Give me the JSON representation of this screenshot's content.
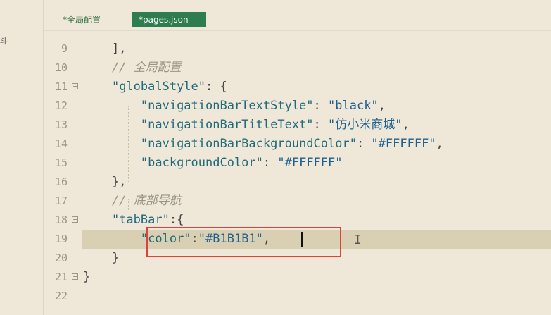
{
  "left_panel": {
    "clipped_text": "斗"
  },
  "tabs": [
    {
      "label": "*全局配置",
      "active": false
    },
    {
      "label": "*pages.json",
      "active": true
    }
  ],
  "editor": {
    "current_line": "19",
    "lines": [
      {
        "num": "9",
        "tokens": [
          {
            "t": "p",
            "v": "    ],"
          }
        ]
      },
      {
        "num": "10",
        "tokens": [
          {
            "t": "c",
            "v": "    // 全局配置"
          }
        ]
      },
      {
        "num": "11",
        "fold": true,
        "tokens": [
          {
            "t": "p",
            "v": "    "
          },
          {
            "t": "k",
            "v": "\"globalStyle\""
          },
          {
            "t": "p",
            "v": ": {"
          }
        ]
      },
      {
        "num": "12",
        "tokens": [
          {
            "t": "p",
            "v": "        "
          },
          {
            "t": "k",
            "v": "\"navigationBarTextStyle\""
          },
          {
            "t": "p",
            "v": ": "
          },
          {
            "t": "s",
            "v": "\"black\""
          },
          {
            "t": "p",
            "v": ","
          }
        ]
      },
      {
        "num": "13",
        "tokens": [
          {
            "t": "p",
            "v": "        "
          },
          {
            "t": "k",
            "v": "\"navigationBarTitleText\""
          },
          {
            "t": "p",
            "v": ": "
          },
          {
            "t": "s",
            "v": "\"仿小米商城\""
          },
          {
            "t": "p",
            "v": ","
          }
        ]
      },
      {
        "num": "14",
        "tokens": [
          {
            "t": "p",
            "v": "        "
          },
          {
            "t": "k",
            "v": "\"navigationBarBackgroundColor\""
          },
          {
            "t": "p",
            "v": ": "
          },
          {
            "t": "s",
            "v": "\"#FFFFFF\""
          },
          {
            "t": "p",
            "v": ","
          }
        ]
      },
      {
        "num": "15",
        "tokens": [
          {
            "t": "p",
            "v": "        "
          },
          {
            "t": "k",
            "v": "\"backgroundColor\""
          },
          {
            "t": "p",
            "v": ": "
          },
          {
            "t": "s",
            "v": "\"#FFFFFF\""
          }
        ]
      },
      {
        "num": "16",
        "tokens": [
          {
            "t": "p",
            "v": "    },"
          }
        ]
      },
      {
        "num": "17",
        "tokens": [
          {
            "t": "c",
            "v": "    // 底部导航"
          }
        ]
      },
      {
        "num": "18",
        "fold": true,
        "tokens": [
          {
            "t": "p",
            "v": "    "
          },
          {
            "t": "k",
            "v": "\"tabBar\""
          },
          {
            "t": "p",
            "v": ":{"
          }
        ]
      },
      {
        "num": "19",
        "tokens": [
          {
            "t": "p",
            "v": "        "
          },
          {
            "t": "k",
            "v": "\"color\""
          },
          {
            "t": "p",
            "v": ":"
          },
          {
            "t": "s",
            "v": "\"#B1B1B1\""
          },
          {
            "t": "p",
            "v": ","
          }
        ]
      },
      {
        "num": "20",
        "tokens": [
          {
            "t": "p",
            "v": "    }"
          }
        ]
      },
      {
        "num": "21",
        "fold": true,
        "tokens": [
          {
            "t": "p",
            "v": "}"
          }
        ]
      },
      {
        "num": "22",
        "tokens": []
      }
    ]
  },
  "colors": {
    "active_tab": "#2e7d4f",
    "highlight_box": "#e0423a",
    "current_line": "#d9d0b4",
    "editor_bg": "#efe8d8"
  }
}
